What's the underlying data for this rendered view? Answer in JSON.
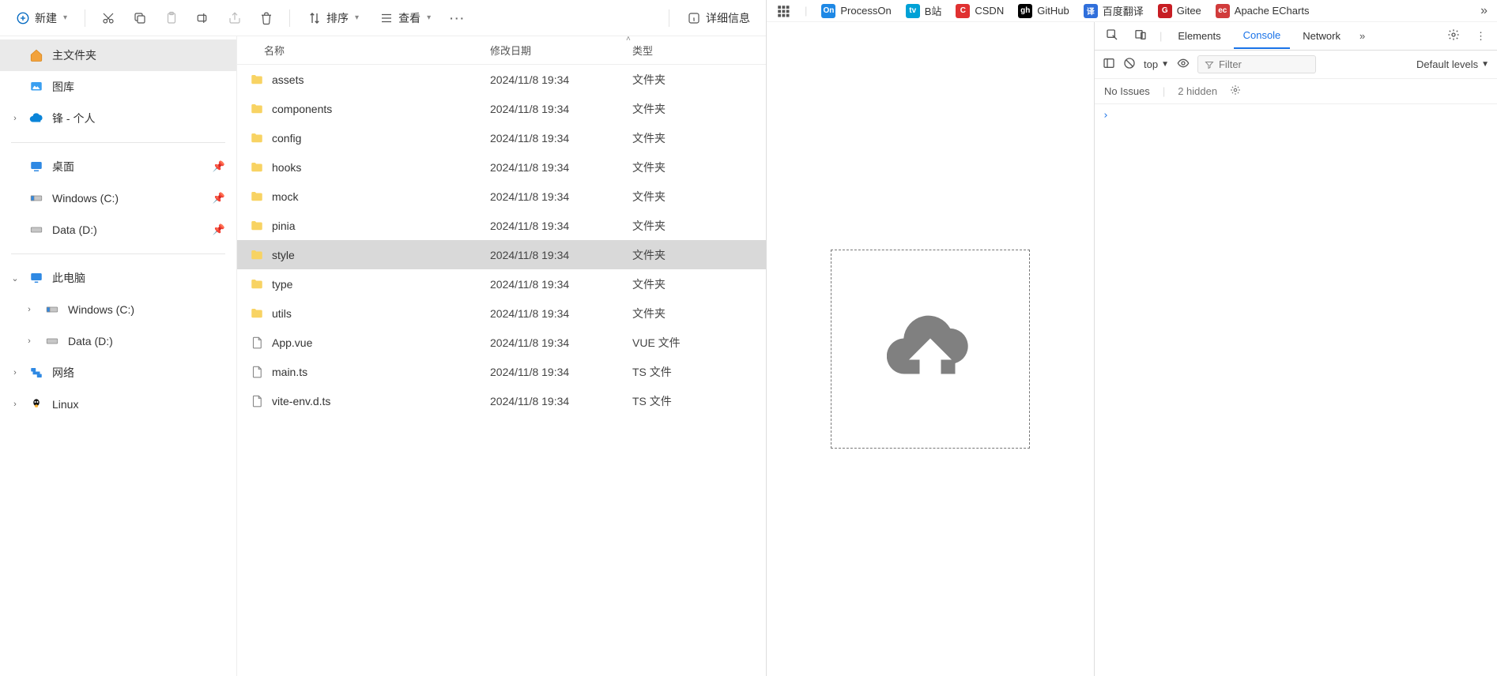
{
  "toolbar": {
    "new_label": "新建",
    "sort_label": "排序",
    "view_label": "查看",
    "details_label": "详细信息"
  },
  "sidebar": {
    "home": "主文件夹",
    "gallery": "图库",
    "onedrive": "锋 - 个人",
    "desktop": "桌面",
    "drive_c": "Windows (C:)",
    "drive_d": "Data (D:)",
    "this_pc": "此电脑",
    "pc_c": "Windows (C:)",
    "pc_d": "Data (D:)",
    "network": "网络",
    "linux": "Linux"
  },
  "columns": {
    "name": "名称",
    "date": "修改日期",
    "type": "类型"
  },
  "files": [
    {
      "name": "assets",
      "date": "2024/11/8 19:34",
      "type": "文件夹",
      "kind": "folder"
    },
    {
      "name": "components",
      "date": "2024/11/8 19:34",
      "type": "文件夹",
      "kind": "folder"
    },
    {
      "name": "config",
      "date": "2024/11/8 19:34",
      "type": "文件夹",
      "kind": "folder"
    },
    {
      "name": "hooks",
      "date": "2024/11/8 19:34",
      "type": "文件夹",
      "kind": "folder"
    },
    {
      "name": "mock",
      "date": "2024/11/8 19:34",
      "type": "文件夹",
      "kind": "folder"
    },
    {
      "name": "pinia",
      "date": "2024/11/8 19:34",
      "type": "文件夹",
      "kind": "folder"
    },
    {
      "name": "style",
      "date": "2024/11/8 19:34",
      "type": "文件夹",
      "kind": "folder",
      "selected": true
    },
    {
      "name": "type",
      "date": "2024/11/8 19:34",
      "type": "文件夹",
      "kind": "folder"
    },
    {
      "name": "utils",
      "date": "2024/11/8 19:34",
      "type": "文件夹",
      "kind": "folder"
    },
    {
      "name": "App.vue",
      "date": "2024/11/8 19:34",
      "type": "VUE 文件",
      "kind": "file"
    },
    {
      "name": "main.ts",
      "date": "2024/11/8 19:34",
      "type": "TS 文件",
      "kind": "file"
    },
    {
      "name": "vite-env.d.ts",
      "date": "2024/11/8 19:34",
      "type": "TS 文件",
      "kind": "file"
    }
  ],
  "bookmarks": [
    {
      "label": "ProcessOn",
      "badge": "On",
      "color": "#1e88e5"
    },
    {
      "label": "B站",
      "badge": "tv",
      "color": "#00a1d6"
    },
    {
      "label": "CSDN",
      "badge": "C",
      "color": "#e03131"
    },
    {
      "label": "GitHub",
      "badge": "gh",
      "color": "#000000"
    },
    {
      "label": "百度翻译",
      "badge": "译",
      "color": "#2f6fdb"
    },
    {
      "label": "Gitee",
      "badge": "G",
      "color": "#c71d23"
    },
    {
      "label": "Apache ECharts",
      "badge": "ec",
      "color": "#d13b3b"
    }
  ],
  "devtools": {
    "tabs": {
      "elements": "Elements",
      "console": "Console",
      "network": "Network"
    },
    "context": "top",
    "filter_placeholder": "Filter",
    "levels": "Default levels",
    "issues": "No Issues",
    "hidden": "2 hidden"
  }
}
